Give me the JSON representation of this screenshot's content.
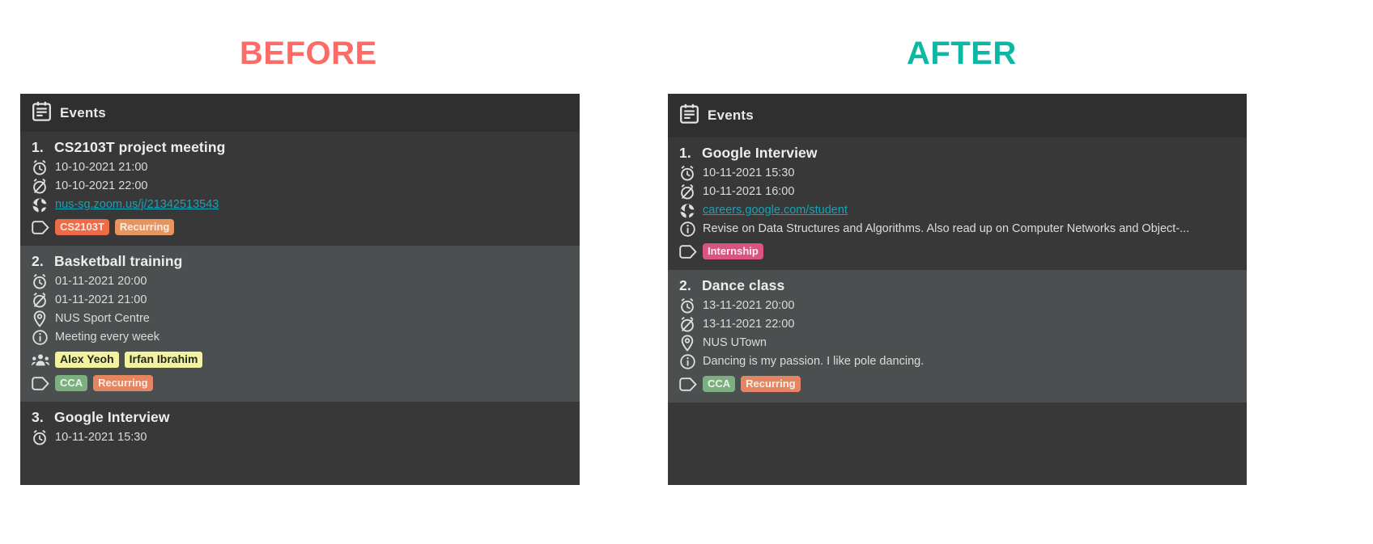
{
  "captions": {
    "before": "BEFORE",
    "after": "AFTER"
  },
  "colors": {
    "caption_before": "#fc6b66",
    "caption_after": "#0cb8a4",
    "panel_bg": "#383838",
    "card_alt_bg": "#4b4f4f",
    "header_bg": "#2f2f2f",
    "link": "#17a3b8",
    "tag_cs2103t_bg": "#ef6a47",
    "tag_recurring_bg": "#e8945e",
    "tag_recurring_alt_bg": "#e58562",
    "tag_cca_bg": "#7dae7f",
    "tag_internship_bg": "#d9547f",
    "tag_person_bg": "#f2f2a0"
  },
  "icons": {
    "header": "calendar-icon",
    "start": "alarm-clock-icon",
    "end": "alarm-clock-off-icon",
    "location": "map-pin-icon",
    "description": "info-circle-icon",
    "persons": "people-group-icon",
    "tags": "tag-icon",
    "link": "globe-icon"
  },
  "before": {
    "header": {
      "title": "Events"
    },
    "events": [
      {
        "index": "1.",
        "name": "CS2103T project meeting",
        "start": "10-10-2021 21:00",
        "end": "10-10-2021 22:00",
        "link": "nus-sg.zoom.us/j/21342513543",
        "tags": [
          {
            "label": "CS2103T",
            "bg": "#ef6a47",
            "fg": "#f7e6e0"
          },
          {
            "label": "Recurring",
            "bg": "#e8945e",
            "fg": "#f7ece4"
          }
        ]
      },
      {
        "index": "2.",
        "name": "Basketball training",
        "start": "01-11-2021 20:00",
        "end": "01-11-2021 21:00",
        "location": "NUS Sport Centre",
        "description": "Meeting every week",
        "persons": [
          {
            "label": "Alex Yeoh",
            "bg": "#f2f2a0",
            "fg": "#23291f"
          },
          {
            "label": "Irfan Ibrahim",
            "bg": "#f2f2a0",
            "fg": "#23291f"
          }
        ],
        "tags": [
          {
            "label": "CCA",
            "bg": "#7dae7f",
            "fg": "#e9f3e9"
          },
          {
            "label": "Recurring",
            "bg": "#e58562",
            "fg": "#f7ece4"
          }
        ]
      },
      {
        "index": "3.",
        "name": "Google Interview",
        "start": "10-11-2021 15:30"
      }
    ]
  },
  "after": {
    "header": {
      "title": "Events"
    },
    "events": [
      {
        "index": "1.",
        "name": "Google Interview",
        "start": "10-11-2021 15:30",
        "end": "10-11-2021 16:00",
        "link": "careers.google.com/student",
        "description": "Revise on Data Structures and Algorithms. Also read up on Computer Networks and Object-...",
        "tags": [
          {
            "label": "Internship",
            "bg": "#d9547f",
            "fg": "#fbeaf0"
          }
        ]
      },
      {
        "index": "2.",
        "name": "Dance class",
        "start": "13-11-2021 20:00",
        "end": "13-11-2021 22:00",
        "location": "NUS UTown",
        "description": "Dancing is my passion. I like pole dancing.",
        "tags": [
          {
            "label": "CCA",
            "bg": "#7dae7f",
            "fg": "#e9f3e9"
          },
          {
            "label": "Recurring",
            "bg": "#e58562",
            "fg": "#f7ece4"
          }
        ]
      }
    ]
  }
}
